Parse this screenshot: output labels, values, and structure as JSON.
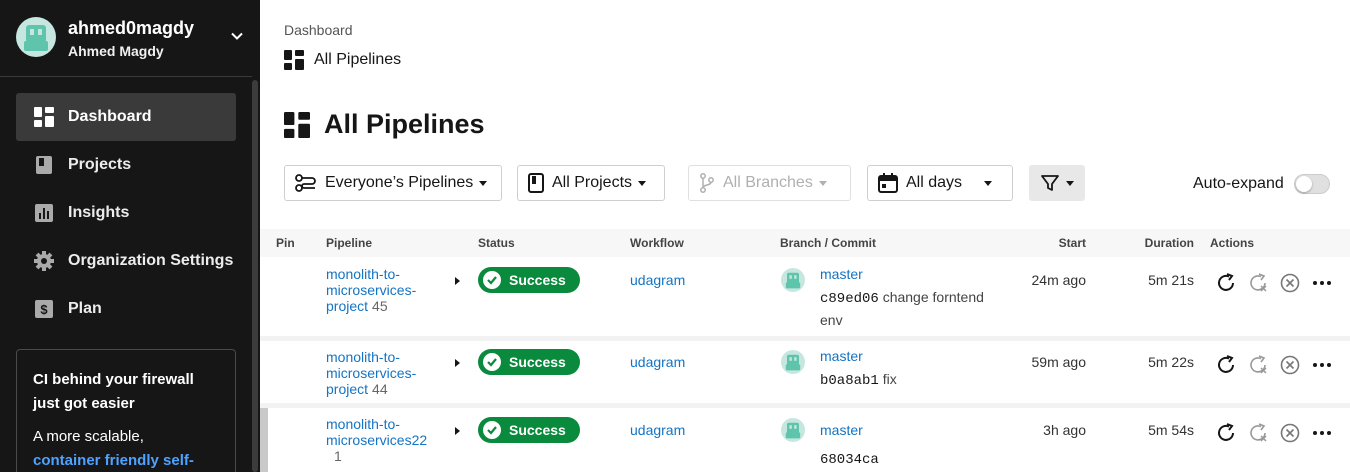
{
  "user": {
    "username": "ahmed0magdy",
    "full_name": "Ahmed Magdy"
  },
  "sidebar": {
    "items": [
      {
        "label": "Dashboard",
        "icon": "dashboard-icon",
        "active": true
      },
      {
        "label": "Projects",
        "icon": "projects-icon"
      },
      {
        "label": "Insights",
        "icon": "insights-icon"
      },
      {
        "label": "Organization Settings",
        "icon": "gear-icon"
      },
      {
        "label": "Plan",
        "icon": "dollar-icon"
      }
    ],
    "promo": {
      "title": "CI behind your firewall just got easier",
      "body": "A more scalable,",
      "link": "container friendly self-"
    }
  },
  "breadcrumb": {
    "parent": "Dashboard",
    "current": "All Pipelines"
  },
  "page": {
    "title": "All Pipelines"
  },
  "filters": {
    "pipelines": "Everyone’s Pipelines",
    "projects": "All Projects",
    "branches": "All Branches",
    "days": "All days",
    "auto_expand": "Auto-expand"
  },
  "table": {
    "headers": {
      "pin": "Pin",
      "pipeline": "Pipeline",
      "status": "Status",
      "workflow": "Workflow",
      "branch": "Branch / Commit",
      "start": "Start",
      "duration": "Duration",
      "actions": "Actions"
    },
    "rows": [
      {
        "pipeline_line1": "monolith-to-",
        "pipeline_line2": "microservices-",
        "pipeline_line3": "project",
        "number": "45",
        "status": "Success",
        "workflow": "udagram",
        "branch": "master",
        "commit_hash": "c89ed06",
        "commit_msg": "change forntend",
        "commit_msg2": "env",
        "start": "24m ago",
        "duration": "5m 21s"
      },
      {
        "pipeline_line1": "monolith-to-",
        "pipeline_line2": "microservices-",
        "pipeline_line3": "project",
        "number": "44",
        "status": "Success",
        "workflow": "udagram",
        "branch": "master",
        "commit_hash": "b0a8ab1",
        "commit_msg": "fix",
        "start": "59m ago",
        "duration": "5m 22s"
      },
      {
        "pipeline_line1": "monolith-to-",
        "pipeline_line2": "microservices22",
        "number": "1",
        "status": "Success",
        "workflow": "udagram",
        "branch": "master",
        "commit_hash": "68034ca",
        "start": "3h ago",
        "duration": "5m 54s"
      }
    ]
  },
  "colors": {
    "sidebar_bg": "#161616",
    "success": "#0a8a3c",
    "link": "#1474c4",
    "promo_link": "#4fa2ff"
  }
}
